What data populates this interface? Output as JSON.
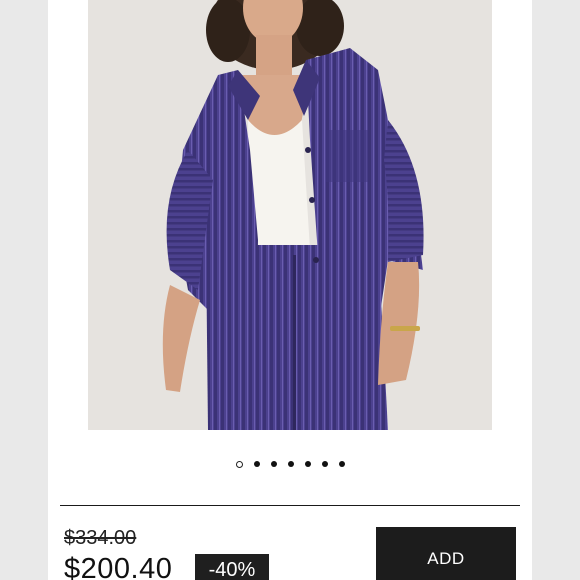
{
  "product": {
    "image_alt": "purple corduroy shirt",
    "carousel": {
      "count": 7,
      "active_index": 0
    },
    "price": {
      "original": "$334.00",
      "current": "$200.40",
      "discount": "-40%"
    },
    "add_label": "ADD"
  },
  "colors": {
    "corduroy": "#4a3f8c",
    "button": "#1c1c1c"
  }
}
